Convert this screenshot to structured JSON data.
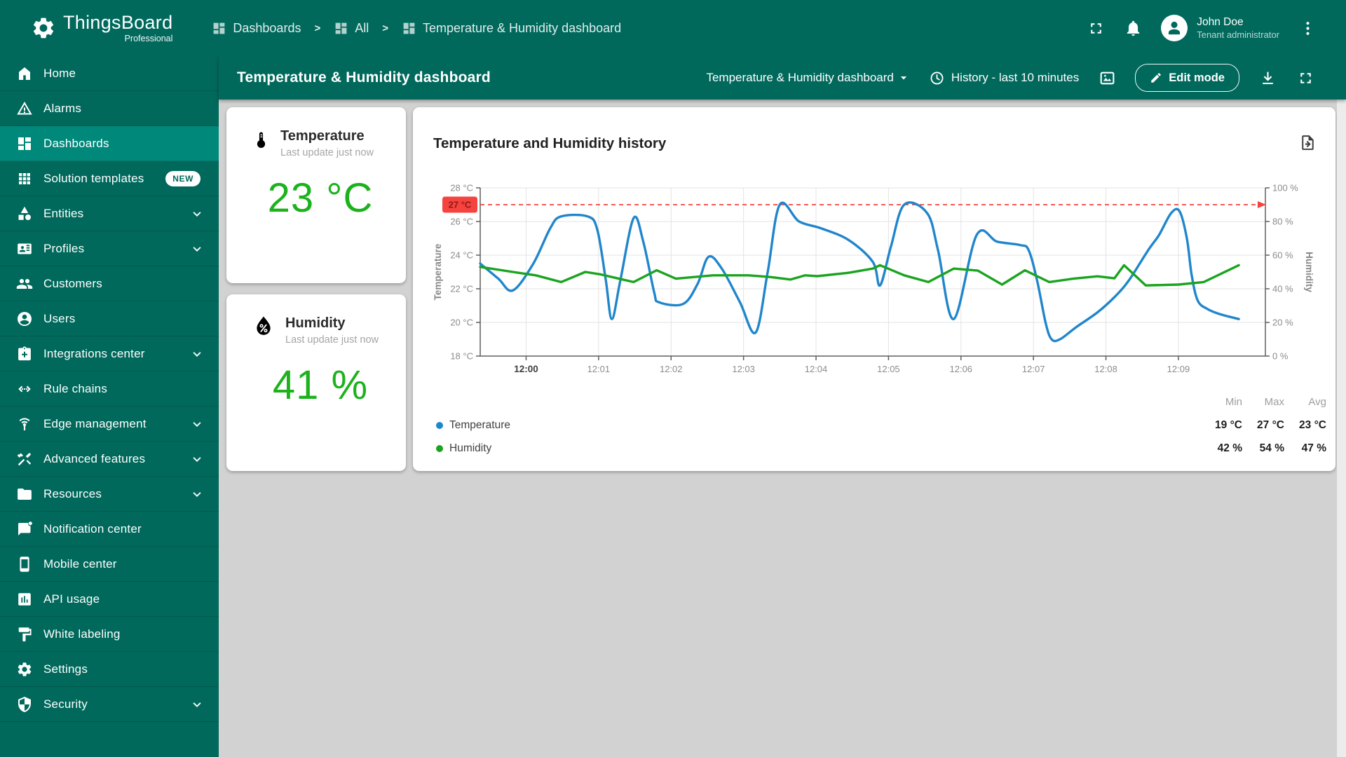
{
  "app": {
    "logo_title": "ThingsBoard",
    "logo_subtitle": "Professional"
  },
  "colors": {
    "primary": "#00695C",
    "primary_selected": "#00897B",
    "content_bg": "#D2D2D2",
    "value_green": "#1CB21C",
    "chart_blue": "#2086CC",
    "chart_green": "#1AA41F",
    "threshold_red": "#F5433F"
  },
  "header": {
    "breadcrumb": [
      {
        "label": "Dashboards",
        "icon": "dashboards-icon"
      },
      {
        "label": "All",
        "icon": "dashboards-icon"
      },
      {
        "label": "Temperature & Humidity dashboard",
        "icon": "dashboards-icon"
      }
    ],
    "user": {
      "name": "John Doe",
      "role": "Tenant administrator"
    }
  },
  "sidebar": {
    "items": [
      {
        "label": "Home",
        "icon": "home-icon"
      },
      {
        "label": "Alarms",
        "icon": "alarms-icon"
      },
      {
        "label": "Dashboards",
        "icon": "dashboards-icon",
        "selected": true
      },
      {
        "label": "Solution templates",
        "icon": "solution-templates-icon",
        "badge": "NEW"
      },
      {
        "label": "Entities",
        "icon": "entities-icon",
        "expandable": true
      },
      {
        "label": "Profiles",
        "icon": "profiles-icon",
        "expandable": true
      },
      {
        "label": "Customers",
        "icon": "customers-icon"
      },
      {
        "label": "Users",
        "icon": "users-icon"
      },
      {
        "label": "Integrations center",
        "icon": "integrations-icon",
        "expandable": true
      },
      {
        "label": "Rule chains",
        "icon": "rule-chains-icon"
      },
      {
        "label": "Edge management",
        "icon": "edge-management-icon",
        "expandable": true
      },
      {
        "label": "Advanced features",
        "icon": "advanced-features-icon",
        "expandable": true
      },
      {
        "label": "Resources",
        "icon": "resources-icon",
        "expandable": true
      },
      {
        "label": "Notification center",
        "icon": "notification-center-icon"
      },
      {
        "label": "Mobile center",
        "icon": "mobile-center-icon"
      },
      {
        "label": "API usage",
        "icon": "api-usage-icon"
      },
      {
        "label": "White labeling",
        "icon": "white-labeling-icon"
      },
      {
        "label": "Settings",
        "icon": "settings-icon"
      },
      {
        "label": "Security",
        "icon": "security-icon",
        "expandable": true
      }
    ]
  },
  "toolbar": {
    "title": "Temperature & Humidity dashboard",
    "dashboard_select": "Temperature & Humidity dashboard",
    "time_window": "History - last 10 minutes",
    "edit_label": "Edit mode"
  },
  "cards": {
    "temperature": {
      "title": "Temperature",
      "subtitle": "Last update just now",
      "value": "23 °C",
      "icon": "thermometer-icon",
      "color": "#1CB21C"
    },
    "humidity": {
      "title": "Humidity",
      "subtitle": "Last update just now",
      "value": "41 %",
      "icon": "droplet-icon",
      "color": "#1CB21C"
    }
  },
  "chart_card": {
    "title": "Temperature and Humidity history",
    "stats_headers": [
      "Min",
      "Max",
      "Avg"
    ],
    "legend": [
      {
        "label": "Temperature",
        "color": "#2086CC",
        "min": "19 °C",
        "max": "27 °C",
        "avg": "23 °C"
      },
      {
        "label": "Humidity",
        "color": "#1AA41F",
        "min": "42 %",
        "max": "54 %",
        "avg": "47 %"
      }
    ]
  },
  "chart_data": {
    "type": "line",
    "title": "Temperature and Humidity history",
    "x_total_seconds": 650,
    "x_ticks": [
      {
        "t": 38,
        "label": "12:00",
        "strong": true
      },
      {
        "t": 98,
        "label": "12:01"
      },
      {
        "t": 158,
        "label": "12:02"
      },
      {
        "t": 218,
        "label": "12:03"
      },
      {
        "t": 278,
        "label": "12:04"
      },
      {
        "t": 338,
        "label": "12:05"
      },
      {
        "t": 398,
        "label": "12:06"
      },
      {
        "t": 458,
        "label": "12:07"
      },
      {
        "t": 518,
        "label": "12:08"
      },
      {
        "t": 578,
        "label": "12:09"
      }
    ],
    "y_left": {
      "title": "Temperature",
      "unit": "°C",
      "min": 18,
      "max": 28,
      "tick_step": 2
    },
    "y_right": {
      "title": "Humidity",
      "unit": "%",
      "min": 0,
      "max": 100,
      "tick_step": 20
    },
    "threshold": {
      "value": 27,
      "label": "27 °C",
      "color": "#F5433F",
      "text_color": "#8E1A15"
    },
    "series": [
      {
        "id": "temperature",
        "name": "Temperature",
        "color": "#2086CC",
        "axis": "left",
        "smooth": true,
        "points": [
          [
            0,
            23.5
          ],
          [
            15,
            22.6
          ],
          [
            27,
            21.9
          ],
          [
            44,
            23.5
          ],
          [
            58,
            25.6
          ],
          [
            67,
            26.3
          ],
          [
            89,
            26.3
          ],
          [
            97,
            25.5
          ],
          [
            104,
            22.5
          ],
          [
            109,
            20.2
          ],
          [
            116,
            22.5
          ],
          [
            127,
            26.2
          ],
          [
            135,
            24.8
          ],
          [
            144,
            21.8
          ],
          [
            148,
            21.2
          ],
          [
            168,
            21.1
          ],
          [
            180,
            22.3
          ],
          [
            189,
            23.9
          ],
          [
            200,
            23.2
          ],
          [
            215,
            21.2
          ],
          [
            228,
            19.4
          ],
          [
            238,
            23.0
          ],
          [
            248,
            27.0
          ],
          [
            264,
            26.0
          ],
          [
            282,
            25.6
          ],
          [
            305,
            24.9
          ],
          [
            325,
            23.6
          ],
          [
            331,
            22.2
          ],
          [
            340,
            24.5
          ],
          [
            351,
            27.0
          ],
          [
            370,
            26.5
          ],
          [
            379,
            24.3
          ],
          [
            392,
            20.2
          ],
          [
            411,
            25.2
          ],
          [
            428,
            24.8
          ],
          [
            447,
            24.6
          ],
          [
            454,
            24.3
          ],
          [
            461,
            22.5
          ],
          [
            468,
            20.0
          ],
          [
            473,
            19.0
          ],
          [
            480,
            19.0
          ],
          [
            493,
            19.7
          ],
          [
            511,
            20.6
          ],
          [
            525,
            21.5
          ],
          [
            537,
            22.5
          ],
          [
            553,
            24.3
          ],
          [
            562,
            25.2
          ],
          [
            572,
            26.5
          ],
          [
            579,
            26.6
          ],
          [
            585,
            25.0
          ],
          [
            589,
            22.8
          ],
          [
            594,
            21.3
          ],
          [
            602,
            20.8
          ],
          [
            612,
            20.5
          ],
          [
            628,
            20.2
          ]
        ]
      },
      {
        "id": "humidity",
        "name": "Humidity",
        "color": "#1AA41F",
        "axis": "right",
        "smooth": false,
        "points": [
          [
            0,
            53
          ],
          [
            27,
            50
          ],
          [
            46,
            48
          ],
          [
            67,
            44
          ],
          [
            87,
            50
          ],
          [
            100,
            48.5
          ],
          [
            118,
            45.5
          ],
          [
            127,
            44
          ],
          [
            146,
            51
          ],
          [
            162,
            46
          ],
          [
            193,
            48
          ],
          [
            222,
            48
          ],
          [
            240,
            47
          ],
          [
            257,
            45.5
          ],
          [
            269,
            48
          ],
          [
            279,
            47.5
          ],
          [
            305,
            49.5
          ],
          [
            325,
            52
          ],
          [
            331,
            54
          ],
          [
            351,
            48
          ],
          [
            371,
            44
          ],
          [
            392,
            52
          ],
          [
            412,
            50.8
          ],
          [
            432,
            42.5
          ],
          [
            451,
            51
          ],
          [
            471,
            44
          ],
          [
            491,
            46
          ],
          [
            511,
            47.4
          ],
          [
            525,
            46.2
          ],
          [
            533,
            54
          ],
          [
            551,
            42
          ],
          [
            578,
            42.5
          ],
          [
            599,
            44
          ],
          [
            628,
            54
          ]
        ]
      }
    ]
  }
}
